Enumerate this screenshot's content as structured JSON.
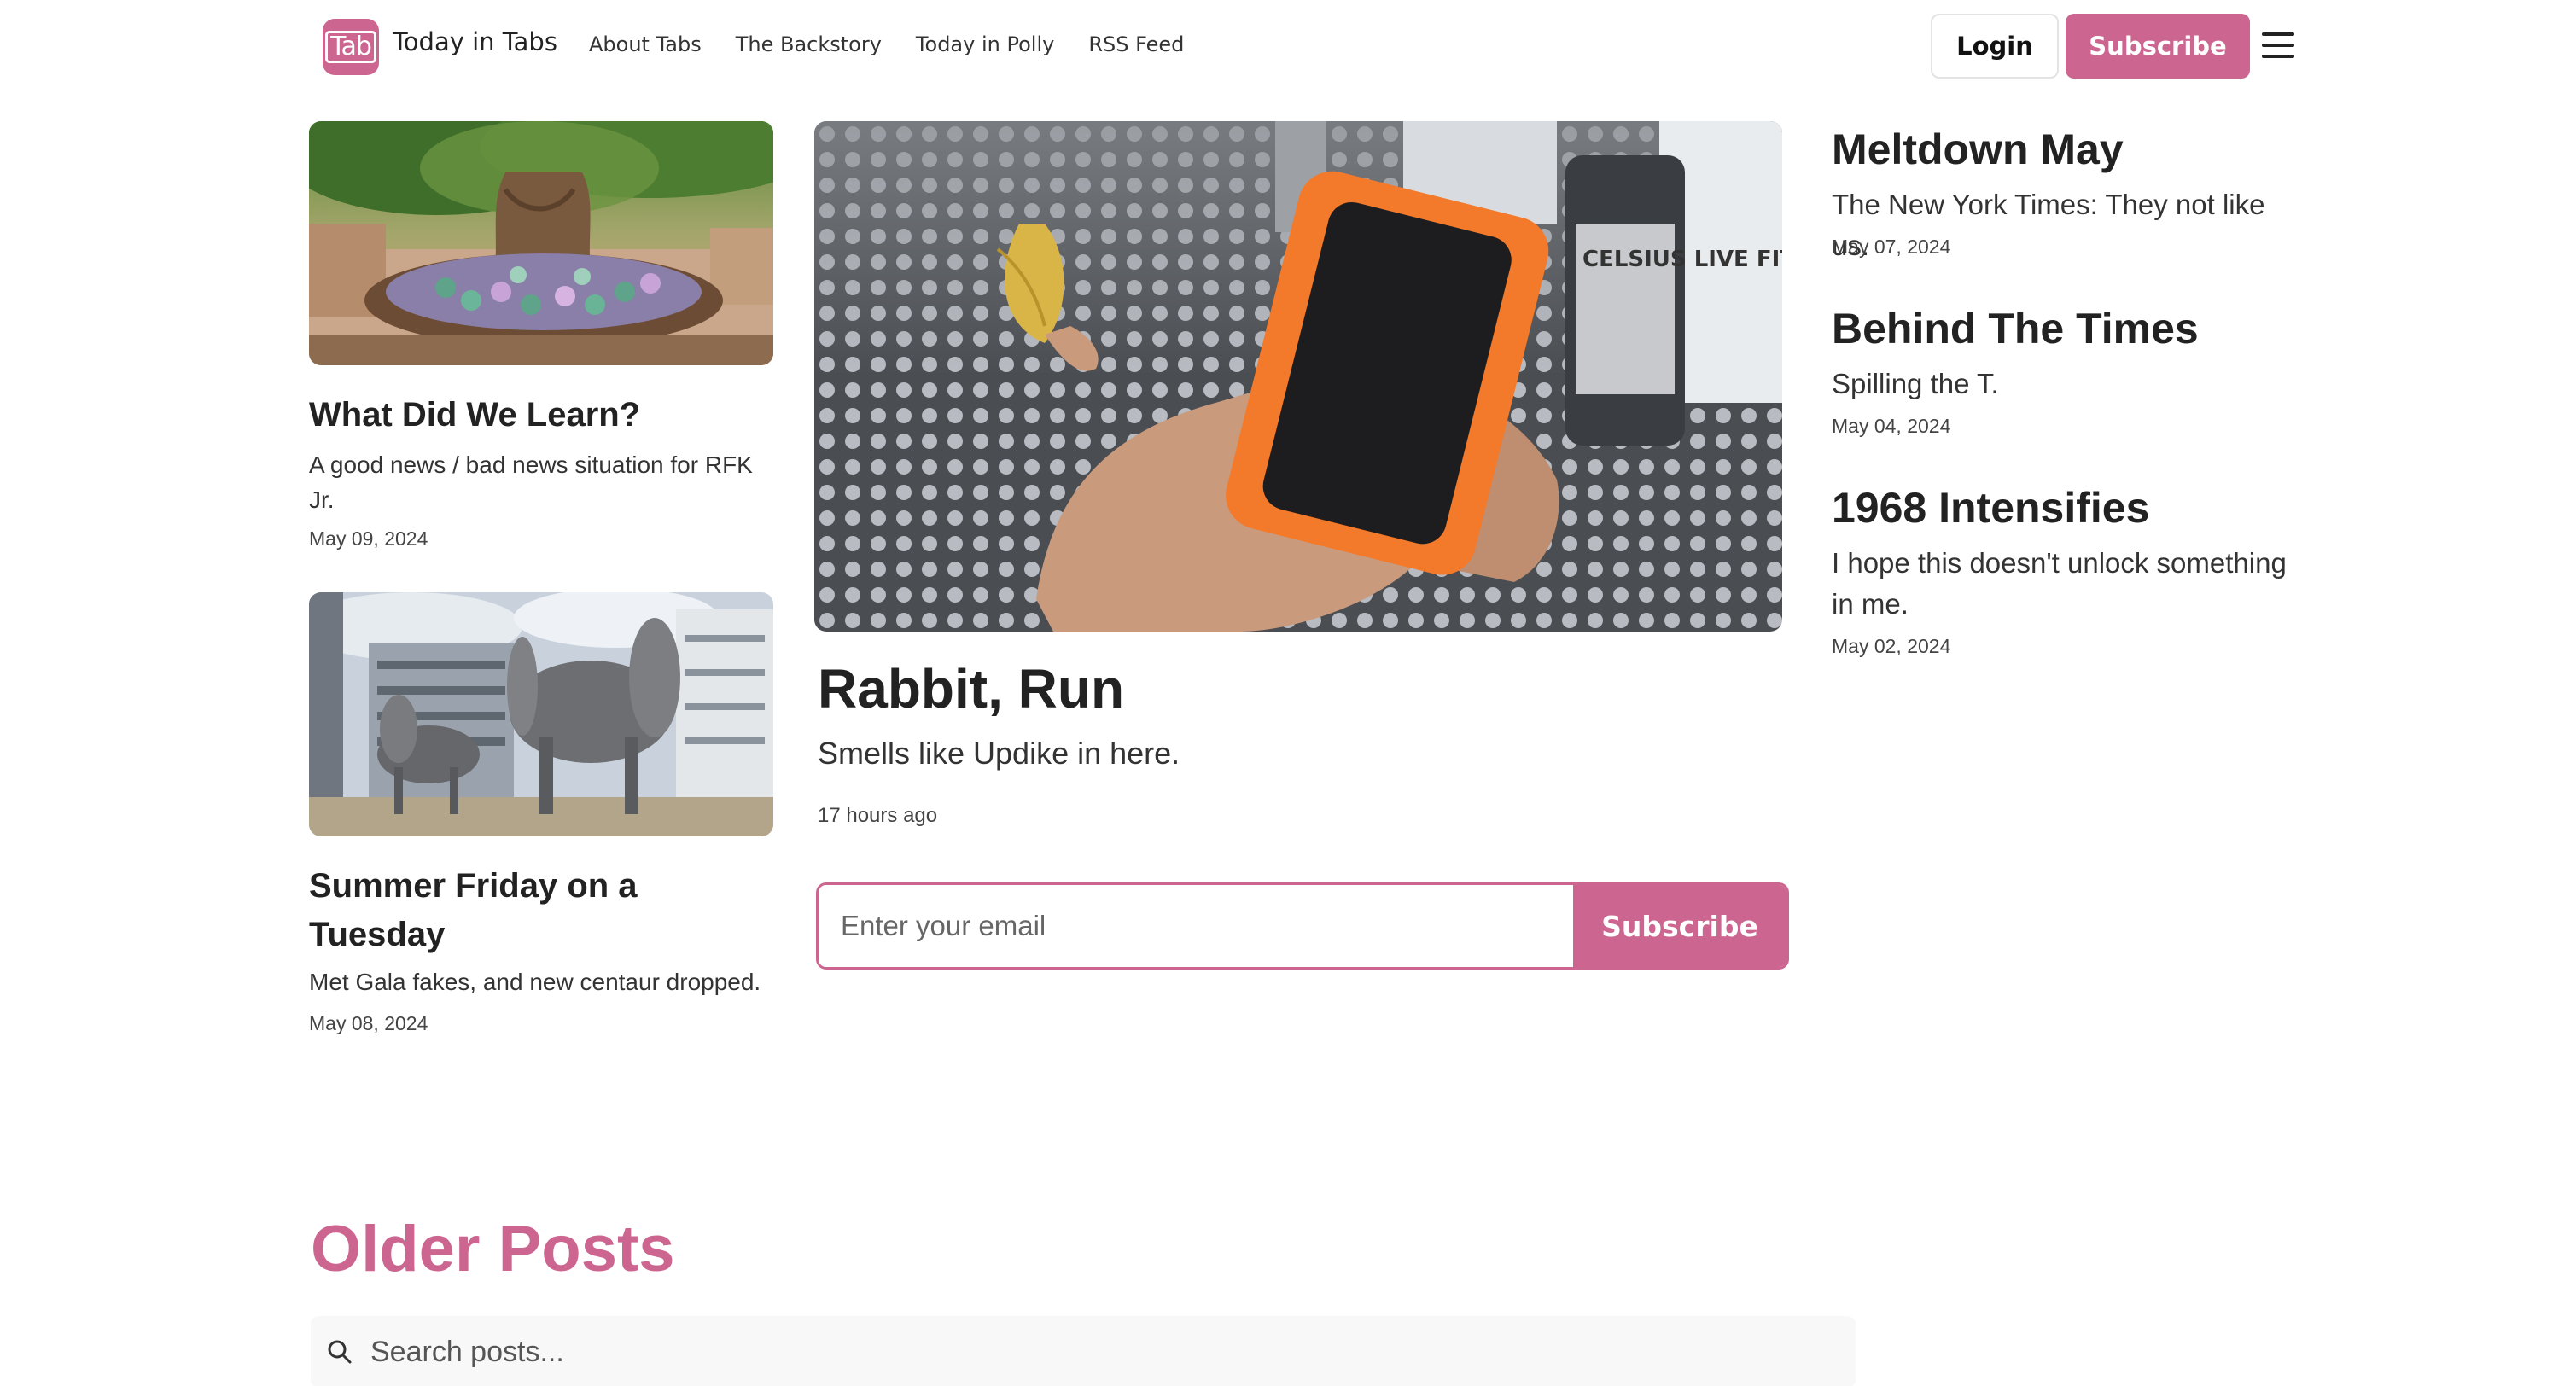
{
  "header": {
    "logo_text": "Tab",
    "site_title": "Today in Tabs",
    "nav": [
      "About Tabs",
      "The Backstory",
      "Today in Polly",
      "RSS Feed"
    ],
    "login_label": "Login",
    "subscribe_label": "Subscribe",
    "menu_icon": "hamburger-menu-icon"
  },
  "left_posts": [
    {
      "title": "What Did We Learn?",
      "description": "A good news / bad news situation for RFK Jr.",
      "date": "May 09, 2024",
      "image": "fairy-tree-display"
    },
    {
      "title": "Summer Friday on a Tuesday",
      "description": "Met Gala fakes, and new centaur dropped.",
      "date": "May 08, 2024",
      "image": "propeller-pig-statues"
    }
  ],
  "featured": {
    "title": "Rabbit, Run",
    "description": "Smells like Updike in here.",
    "date": "17 hours ago",
    "image": "hand-holding-orange-device-and-chip",
    "can_text": "CELSIUS LIVE FIT"
  },
  "signup": {
    "placeholder": "Enter your email",
    "button_label": "Subscribe"
  },
  "side_posts": [
    {
      "title": "Meltdown May",
      "description": "The New York Times: They not like us.",
      "date": "May 07, 2024"
    },
    {
      "title": "Behind The Times",
      "description": "Spilling the T.",
      "date": "May 04, 2024"
    },
    {
      "title": "1968 Intensifies",
      "description": "I hope this doesn't unlock something in me.",
      "date": "May 02, 2024"
    }
  ],
  "older": {
    "title": "Older Posts",
    "search_placeholder": "Search posts..."
  },
  "colors": {
    "accent": "#cc6690",
    "text": "#222222",
    "search_bg": "#f8f8f8"
  }
}
